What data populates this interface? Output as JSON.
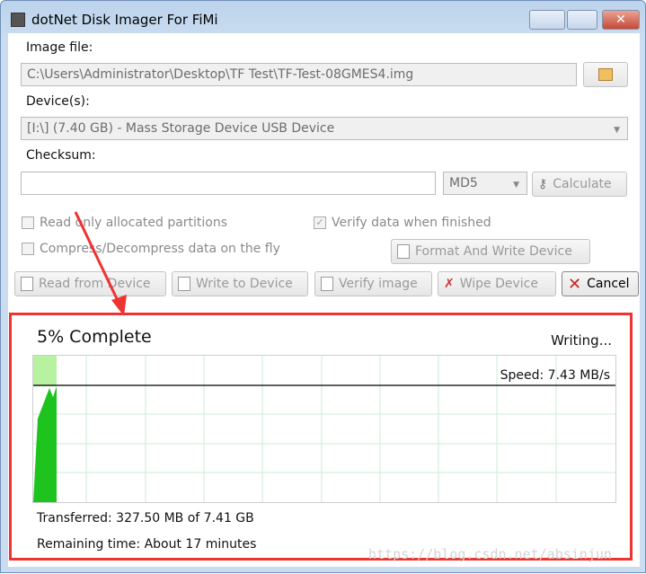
{
  "window": {
    "title": "dotNet Disk Imager For FiMi"
  },
  "image_file": {
    "label": "Image file:",
    "value": "C:\\Users\\Administrator\\Desktop\\TF Test\\TF-Test-08GMES4.img"
  },
  "devices": {
    "label": "Device(s):",
    "selected": "[I:\\] (7.40 GB) - Mass Storage Device USB Device"
  },
  "checksum": {
    "label": "Checksum:",
    "value": "",
    "algorithm": "MD5",
    "calculate": "Calculate"
  },
  "options": {
    "read_only_allocated": {
      "label": "Read only allocated partitions",
      "checked": false
    },
    "compress": {
      "label": "Compress/Decompress data on the fly",
      "checked": false
    },
    "verify": {
      "label": "Verify data when finished",
      "checked": true
    }
  },
  "buttons": {
    "format_write": "Format And Write Device",
    "read": "Read from Device",
    "write": "Write to Device",
    "verify": "Verify image",
    "wipe": "Wipe Device",
    "cancel": "Cancel"
  },
  "progress": {
    "percent_label": "5% Complete",
    "percent": 5,
    "status": "Writing...",
    "speed": "Speed: 7.43 MB/s",
    "transferred": "Transferred: 327.50 MB of 7.41 GB",
    "remaining": "Remaining time: About 17 minutes"
  },
  "watermark": "https://blog.csdn.net/absinjun",
  "colors": {
    "graph_fill": "#1ec31e",
    "graph_light": "#b6f2a0",
    "grid": "#cdebd5",
    "annotation": "#ee3333"
  }
}
